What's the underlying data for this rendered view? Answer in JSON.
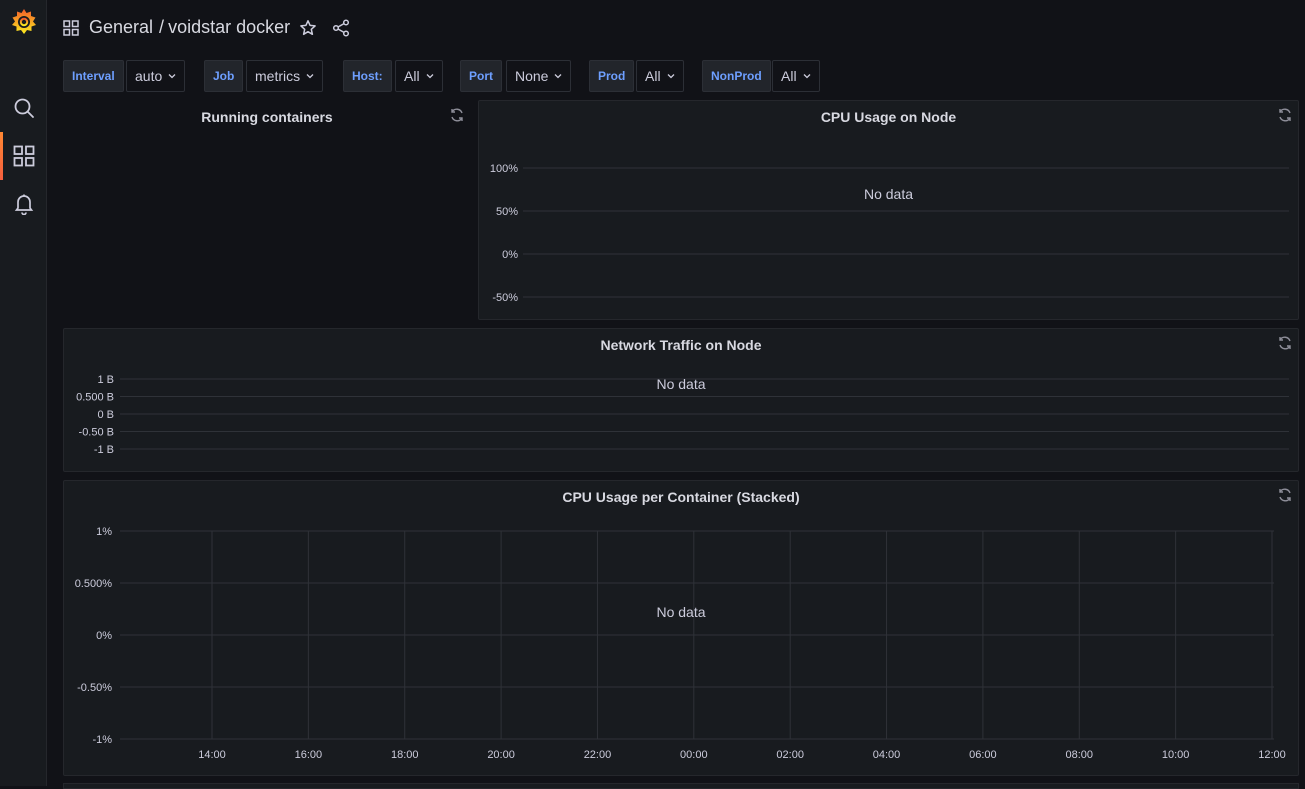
{
  "breadcrumb": {
    "folder": "General",
    "separator": "/",
    "dashboard": "voidstar docker"
  },
  "variables": [
    {
      "label": "Interval",
      "value": "auto"
    },
    {
      "label": "Job",
      "value": "metrics"
    },
    {
      "label": "Host:",
      "value": "All"
    },
    {
      "label": "Port",
      "value": "None"
    },
    {
      "label": "Prod",
      "value": "All"
    },
    {
      "label": "NonProd",
      "value": "All"
    }
  ],
  "panels": {
    "running": {
      "title": "Running containers"
    },
    "cpu_node": {
      "title": "CPU Usage on Node",
      "nodata": "No data"
    },
    "network": {
      "title": "Network Traffic on Node",
      "nodata": "No data"
    },
    "cpu_container": {
      "title": "CPU Usage per Container (Stacked)",
      "nodata": "No data"
    }
  },
  "chart_data": [
    {
      "type": "line",
      "title": "CPU Usage on Node",
      "y_ticks": [
        "100%",
        "50%",
        "0%",
        "-50%"
      ],
      "ylim": [
        -50,
        100
      ],
      "series": [],
      "grid": true
    },
    {
      "type": "line",
      "title": "Network Traffic on Node",
      "y_ticks": [
        "1 B",
        "0.500 B",
        "0 B",
        "-0.50 B",
        "-1 B"
      ],
      "ylim": [
        -1,
        1
      ],
      "series": [],
      "grid": true
    },
    {
      "type": "area",
      "title": "CPU Usage per Container (Stacked)",
      "y_ticks": [
        "1%",
        "0.500%",
        "0%",
        "-0.50%",
        "-1%"
      ],
      "x_ticks": [
        "14:00",
        "16:00",
        "18:00",
        "20:00",
        "22:00",
        "00:00",
        "02:00",
        "04:00",
        "06:00",
        "08:00",
        "10:00",
        "12:00"
      ],
      "ylim": [
        -1,
        1
      ],
      "series": [],
      "grid": true
    }
  ],
  "colors": {
    "accent": "#f55f3e",
    "variable_label": "#6e9fff"
  },
  "icons": {
    "logo": "grafana-logo-icon",
    "search": "search-icon",
    "dashboards": "dashboards-icon",
    "alerting": "bell-icon",
    "star": "star-icon",
    "share": "share-icon",
    "refresh": "refresh-icon"
  }
}
